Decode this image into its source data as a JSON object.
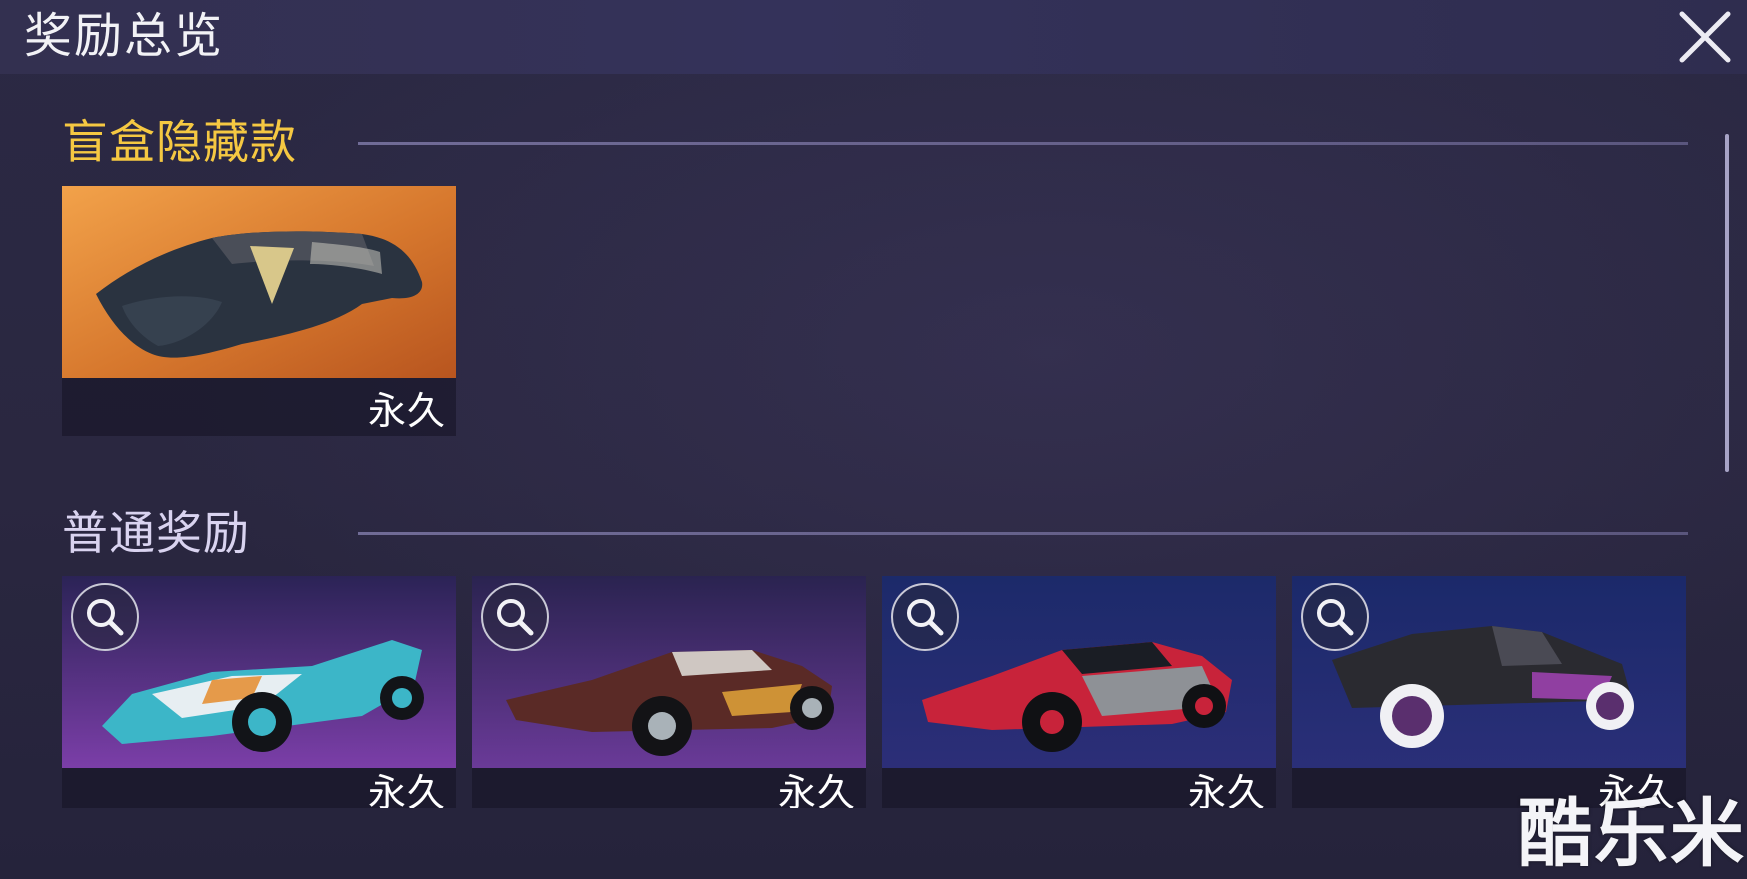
{
  "header": {
    "title": "奖励总览"
  },
  "sections": {
    "hidden": {
      "title": "盲盒隐藏款"
    },
    "normal": {
      "title": "普通奖励"
    }
  },
  "hidden_reward": {
    "duration": "永久",
    "icon": "covered-car-under-cloth"
  },
  "rewards": [
    {
      "duration": "永久",
      "icon": "cyan-open-wheel-racer-car"
    },
    {
      "duration": "永久",
      "icon": "bronze-retro-wedge-sports-car"
    },
    {
      "duration": "永久",
      "icon": "red-gray-sports-car"
    },
    {
      "duration": "永久",
      "icon": "black-purple-buggy"
    }
  ],
  "watermark": "酷乐米",
  "colors": {
    "hidden_section_title": "#f5c842",
    "normal_section_title": "#d9d3f0",
    "background": "#2a2842"
  }
}
